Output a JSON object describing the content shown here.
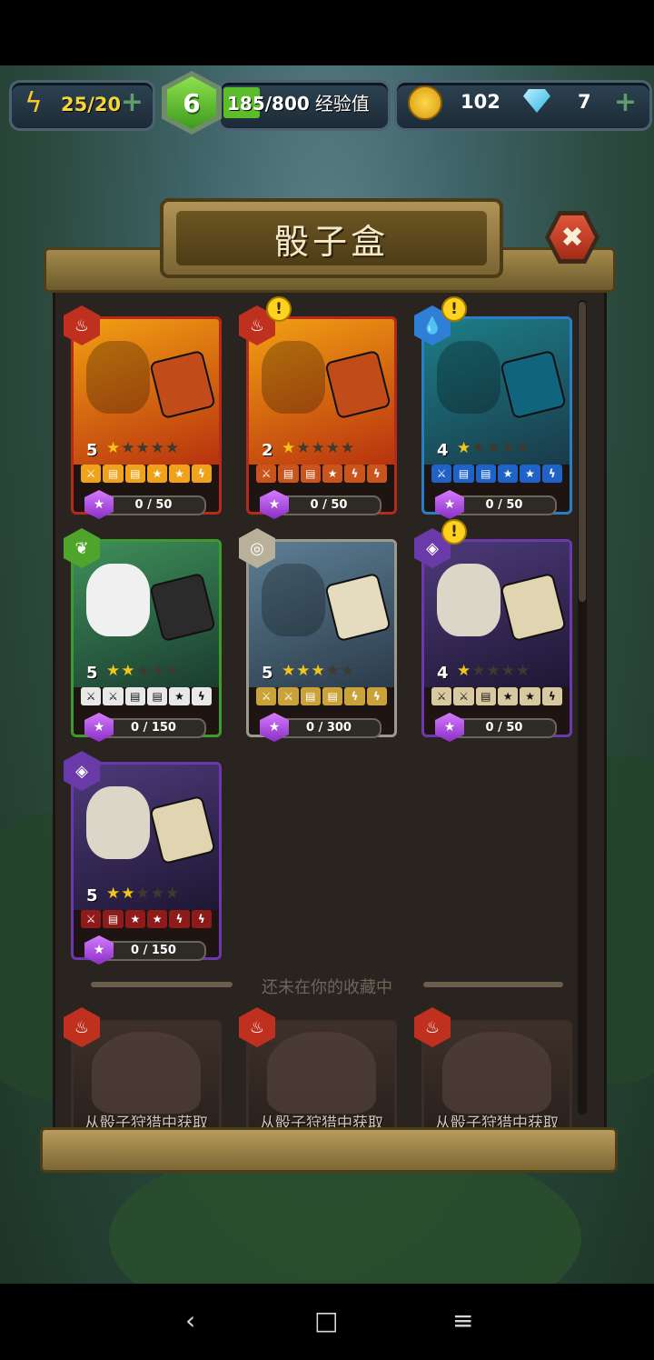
{
  "hud": {
    "energy": "25/20",
    "level": "6",
    "xp": "185/800",
    "xp_label": "经验值",
    "xp_fraction": 0.231,
    "coins": "102",
    "gems": "7",
    "plus_label": "+"
  },
  "dialog": {
    "title": "骰子盒",
    "close_label": "✖",
    "divider_text": "还未在你的收藏中"
  },
  "cards": [
    {
      "element": "fire",
      "level": "5",
      "stars": 1,
      "progress": "0 / 50",
      "warning": false,
      "icons": [
        {
          "t": "⚔",
          "c": "#f0a21b"
        },
        {
          "t": "▤",
          "c": "#f0a21b"
        },
        {
          "t": "▤",
          "c": "#f0a21b"
        },
        {
          "t": "★",
          "c": "#f0a21b"
        },
        {
          "t": "★",
          "c": "#f0a21b"
        },
        {
          "t": "ϟ",
          "c": "#f0a21b"
        }
      ]
    },
    {
      "element": "fire",
      "level": "2",
      "stars": 1,
      "progress": "0 / 50",
      "warning": true,
      "icons": [
        {
          "t": "⚔",
          "c": "#c9541c"
        },
        {
          "t": "▤",
          "c": "#c9541c"
        },
        {
          "t": "▤",
          "c": "#c9541c"
        },
        {
          "t": "★",
          "c": "#c9541c"
        },
        {
          "t": "ϟ",
          "c": "#c9541c"
        },
        {
          "t": "ϟ",
          "c": "#c9541c"
        }
      ]
    },
    {
      "element": "water",
      "level": "4",
      "stars": 1,
      "progress": "0 / 50",
      "warning": true,
      "icons": [
        {
          "t": "⚔",
          "c": "#1f63c9"
        },
        {
          "t": "▤",
          "c": "#1f63c9"
        },
        {
          "t": "▤",
          "c": "#1f63c9"
        },
        {
          "t": "★",
          "c": "#1f63c9"
        },
        {
          "t": "★",
          "c": "#1f63c9"
        },
        {
          "t": "ϟ",
          "c": "#1f63c9"
        }
      ]
    },
    {
      "element": "nature",
      "level": "5",
      "stars": 2,
      "progress": "0 / 150",
      "warning": false,
      "icons": [
        {
          "t": "⚔",
          "c": "#e8e8e8"
        },
        {
          "t": "⚔",
          "c": "#e8e8e8"
        },
        {
          "t": "▤",
          "c": "#e8e8e8"
        },
        {
          "t": "▤",
          "c": "#e8e8e8"
        },
        {
          "t": "★",
          "c": "#e8e8e8"
        },
        {
          "t": "ϟ",
          "c": "#e8e8e8"
        }
      ]
    },
    {
      "element": "air",
      "level": "5",
      "stars": 3,
      "progress": "0 / 300",
      "warning": false,
      "icons": [
        {
          "t": "⚔",
          "c": "#c9a33a"
        },
        {
          "t": "⚔",
          "c": "#c9a33a"
        },
        {
          "t": "▤",
          "c": "#c9a33a"
        },
        {
          "t": "▤",
          "c": "#c9a33a"
        },
        {
          "t": "ϟ",
          "c": "#c9a33a"
        },
        {
          "t": "ϟ",
          "c": "#c9a33a"
        }
      ]
    },
    {
      "element": "dark",
      "level": "4",
      "stars": 1,
      "progress": "0 / 50",
      "warning": true,
      "icons": [
        {
          "t": "⚔",
          "c": "#d9c9a0"
        },
        {
          "t": "⚔",
          "c": "#d9c9a0"
        },
        {
          "t": "▤",
          "c": "#d9c9a0"
        },
        {
          "t": "★",
          "c": "#d9c9a0"
        },
        {
          "t": "★",
          "c": "#d9c9a0"
        },
        {
          "t": "ϟ",
          "c": "#d9c9a0"
        }
      ]
    },
    {
      "element": "dark",
      "level": "5",
      "stars": 2,
      "progress": "0 / 150",
      "warning": false,
      "icons": [
        {
          "t": "⚔",
          "c": "#8f1a1a"
        },
        {
          "t": "▤",
          "c": "#8f1a1a"
        },
        {
          "t": "★",
          "c": "#8f1a1a"
        },
        {
          "t": "★",
          "c": "#8f1a1a"
        },
        {
          "t": "ϟ",
          "c": "#8f1a1a"
        },
        {
          "t": "ϟ",
          "c": "#8f1a1a"
        }
      ]
    }
  ],
  "locked_cards": [
    {
      "element": "fire",
      "label": "从骰子狩猎中获取"
    },
    {
      "element": "fire",
      "label": "从骰子狩猎中获取"
    },
    {
      "element": "fire",
      "label": "从骰子狩猎中获取"
    }
  ],
  "colors": {
    "fire": "#c0301e",
    "water": "#2f7fd6",
    "nature": "#4fa52c",
    "air": "#b9b09a",
    "dark": "#6a3aa8"
  },
  "nav": {
    "back": "‹",
    "home": "□",
    "menu": "≡"
  }
}
